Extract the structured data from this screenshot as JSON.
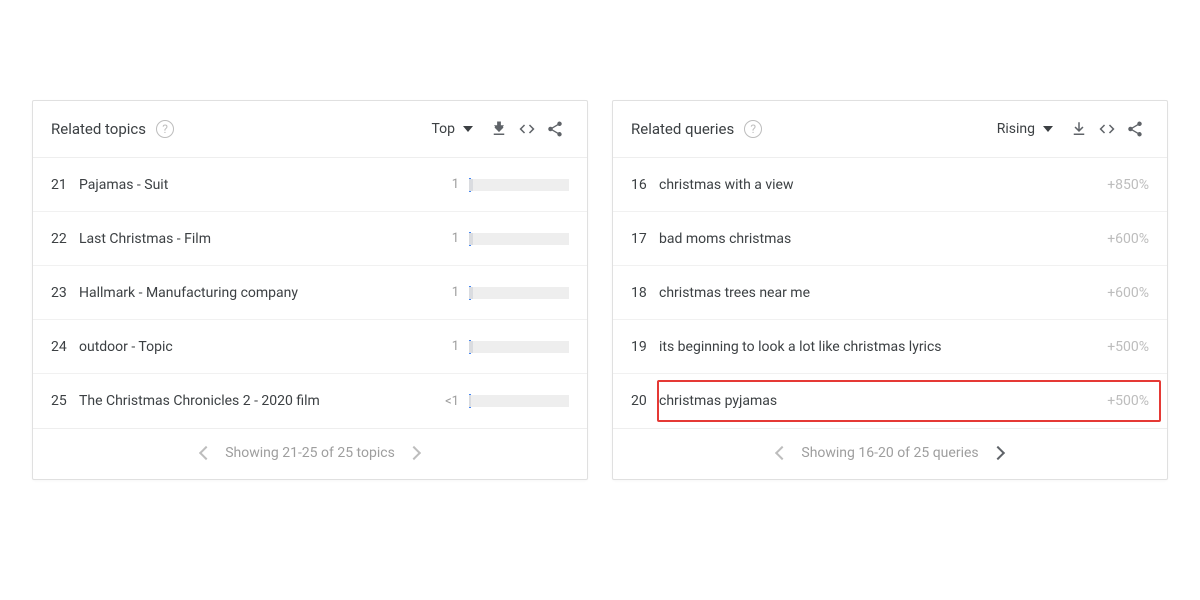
{
  "topics_card": {
    "title": "Related topics",
    "sort": "Top",
    "rows": [
      {
        "rank": "21",
        "label": "Pajamas - Suit",
        "val": "1",
        "bar": 4
      },
      {
        "rank": "22",
        "label": "Last Christmas - Film",
        "val": "1",
        "bar": 4
      },
      {
        "rank": "23",
        "label": "Hallmark - Manufacturing company",
        "val": "1",
        "bar": 4
      },
      {
        "rank": "24",
        "label": "outdoor - Topic",
        "val": "1",
        "bar": 4
      },
      {
        "rank": "25",
        "label": "The Christmas Chronicles 2 - 2020 film",
        "val": "<1",
        "bar": 2
      }
    ],
    "footer": "Showing 21-25 of 25 topics"
  },
  "queries_card": {
    "title": "Related queries",
    "sort": "Rising",
    "rows": [
      {
        "rank": "16",
        "label": "christmas with a view",
        "pct": "+850%"
      },
      {
        "rank": "17",
        "label": "bad moms christmas",
        "pct": "+600%"
      },
      {
        "rank": "18",
        "label": "christmas trees near me",
        "pct": "+600%"
      },
      {
        "rank": "19",
        "label": "its beginning to look a lot like christmas lyrics",
        "pct": "+500%"
      },
      {
        "rank": "20",
        "label": "christmas pyjamas",
        "pct": "+500%",
        "highlight": true
      }
    ],
    "footer": "Showing 16-20 of 25 queries"
  }
}
